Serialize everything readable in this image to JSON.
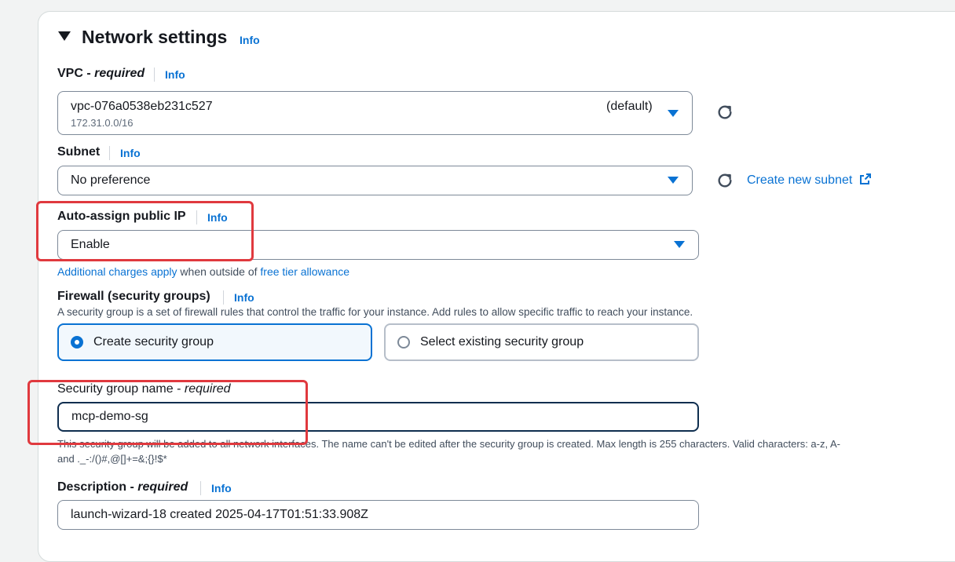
{
  "section": {
    "title": "Network settings",
    "info": "Info"
  },
  "vpc": {
    "label": "VPC - ",
    "required": "required",
    "info": "Info",
    "value": "vpc-076a0538eb231c527",
    "cidr": "172.31.0.0/16",
    "tag": "(default)"
  },
  "subnet": {
    "label": "Subnet",
    "info": "Info",
    "value": "No preference",
    "create_link": "Create new subnet"
  },
  "auto_ip": {
    "label": "Auto-assign public IP",
    "info": "Info",
    "value": "Enable",
    "note_link1": "Additional charges apply",
    "note_mid": " when outside of ",
    "note_link2": "free tier allowance"
  },
  "firewall": {
    "label": "Firewall (security groups)",
    "info": "Info",
    "description": "A security group is a set of firewall rules that control the traffic for your instance. Add rules to allow specific traffic to reach your instance.",
    "option_create": "Create security group",
    "option_existing": "Select existing security group",
    "selected": "create"
  },
  "sg_name": {
    "label": "Security group name - ",
    "required": "required",
    "value": "mcp-demo-sg",
    "help_line1": "This security group will be added to all network interfaces. The name can't be edited after the security group is created. Max length is 255 characters. Valid characters: a-z, A-",
    "help_line2": "and ._-:/()#,@[]+=&;{}!$*"
  },
  "description": {
    "label": "Description - ",
    "required": "required",
    "info": "Info",
    "value": "launch-wizard-18 created 2025-04-17T01:51:33.908Z"
  },
  "colors": {
    "accent": "#0972d3",
    "highlight_border": "#e0393e",
    "selected_bg": "#f2f8fd"
  }
}
